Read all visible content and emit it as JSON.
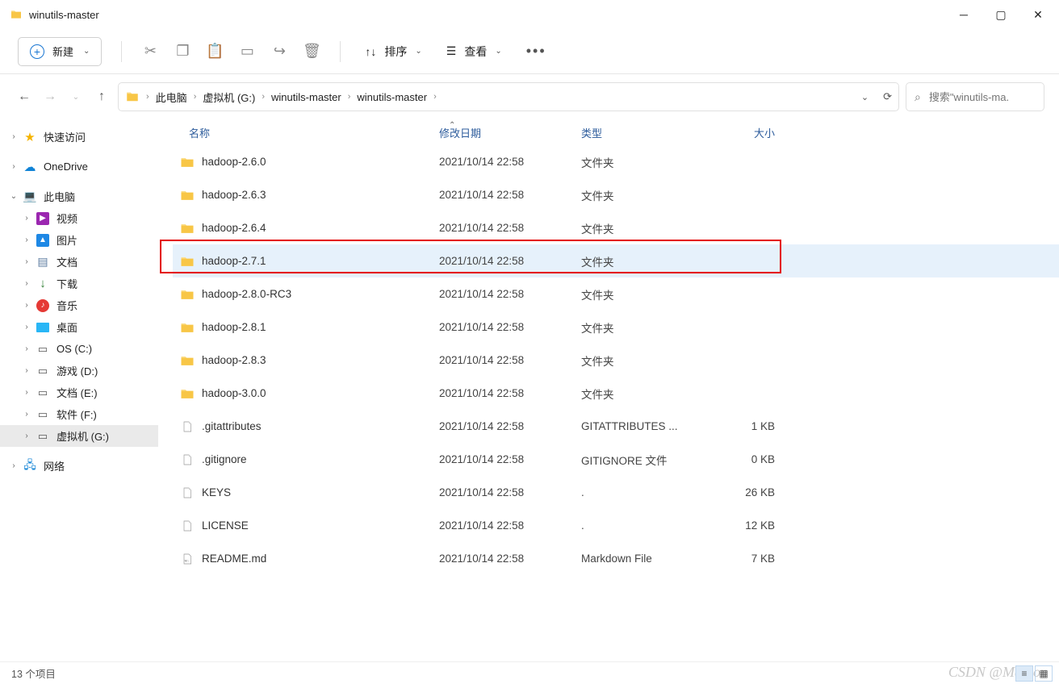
{
  "window": {
    "title": "winutils-master"
  },
  "toolbar": {
    "new_label": "新建",
    "sort_label": "排序",
    "view_label": "查看"
  },
  "breadcrumbs": [
    "此电脑",
    "虚拟机 (G:)",
    "winutils-master",
    "winutils-master"
  ],
  "search": {
    "placeholder": "搜索\"winutils-ma."
  },
  "columns": {
    "name": "名称",
    "date": "修改日期",
    "type": "类型",
    "size": "大小"
  },
  "sidebar": [
    {
      "icon": "star",
      "label": "快速访问",
      "expand": ">",
      "indent": 0
    },
    {
      "icon": "cloud",
      "label": "OneDrive",
      "expand": ">",
      "indent": 0,
      "gapBefore": true
    },
    {
      "icon": "pc",
      "label": "此电脑",
      "expand": "v",
      "indent": 0,
      "gapBefore": true
    },
    {
      "icon": "vid",
      "label": "视频",
      "expand": ">",
      "indent": 1
    },
    {
      "icon": "img",
      "label": "图片",
      "expand": ">",
      "indent": 1
    },
    {
      "icon": "doc",
      "label": "文档",
      "expand": ">",
      "indent": 1
    },
    {
      "icon": "dl",
      "label": "下载",
      "expand": ">",
      "indent": 1
    },
    {
      "icon": "mus",
      "label": "音乐",
      "expand": ">",
      "indent": 1
    },
    {
      "icon": "desk",
      "label": "桌面",
      "expand": ">",
      "indent": 1
    },
    {
      "icon": "drive",
      "label": "OS (C:)",
      "expand": ">",
      "indent": 1
    },
    {
      "icon": "drive",
      "label": "游戏 (D:)",
      "expand": ">",
      "indent": 1
    },
    {
      "icon": "drive",
      "label": "文档 (E:)",
      "expand": ">",
      "indent": 1
    },
    {
      "icon": "drive",
      "label": "软件 (F:)",
      "expand": ">",
      "indent": 1
    },
    {
      "icon": "drive",
      "label": "虚拟机 (G:)",
      "expand": ">",
      "indent": 1,
      "selected": true
    },
    {
      "icon": "net",
      "label": "网络",
      "expand": ">",
      "indent": 0,
      "gapBefore": true
    }
  ],
  "files": [
    {
      "icon": "folder",
      "name": "hadoop-2.6.0",
      "date": "2021/10/14 22:58",
      "type": "文件夹",
      "size": ""
    },
    {
      "icon": "folder",
      "name": "hadoop-2.6.3",
      "date": "2021/10/14 22:58",
      "type": "文件夹",
      "size": ""
    },
    {
      "icon": "folder",
      "name": "hadoop-2.6.4",
      "date": "2021/10/14 22:58",
      "type": "文件夹",
      "size": ""
    },
    {
      "icon": "folder",
      "name": "hadoop-2.7.1",
      "date": "2021/10/14 22:58",
      "type": "文件夹",
      "size": "",
      "highlighted": true
    },
    {
      "icon": "folder",
      "name": "hadoop-2.8.0-RC3",
      "date": "2021/10/14 22:58",
      "type": "文件夹",
      "size": ""
    },
    {
      "icon": "folder",
      "name": "hadoop-2.8.1",
      "date": "2021/10/14 22:58",
      "type": "文件夹",
      "size": ""
    },
    {
      "icon": "folder",
      "name": "hadoop-2.8.3",
      "date": "2021/10/14 22:58",
      "type": "文件夹",
      "size": ""
    },
    {
      "icon": "folder",
      "name": "hadoop-3.0.0",
      "date": "2021/10/14 22:58",
      "type": "文件夹",
      "size": ""
    },
    {
      "icon": "file",
      "name": ".gitattributes",
      "date": "2021/10/14 22:58",
      "type": "GITATTRIBUTES ...",
      "size": "1 KB"
    },
    {
      "icon": "file",
      "name": ".gitignore",
      "date": "2021/10/14 22:58",
      "type": "GITIGNORE 文件",
      "size": "0 KB"
    },
    {
      "icon": "file",
      "name": "KEYS",
      "date": "2021/10/14 22:58",
      "type": ".",
      "size": "26 KB"
    },
    {
      "icon": "file",
      "name": "LICENSE",
      "date": "2021/10/14 22:58",
      "type": ".",
      "size": "12 KB"
    },
    {
      "icon": "md",
      "name": "README.md",
      "date": "2021/10/14 22:58",
      "type": "Markdown File",
      "size": "7 KB"
    }
  ],
  "status": {
    "count": "13 个项目"
  },
  "watermark": "CSDN @Marson"
}
